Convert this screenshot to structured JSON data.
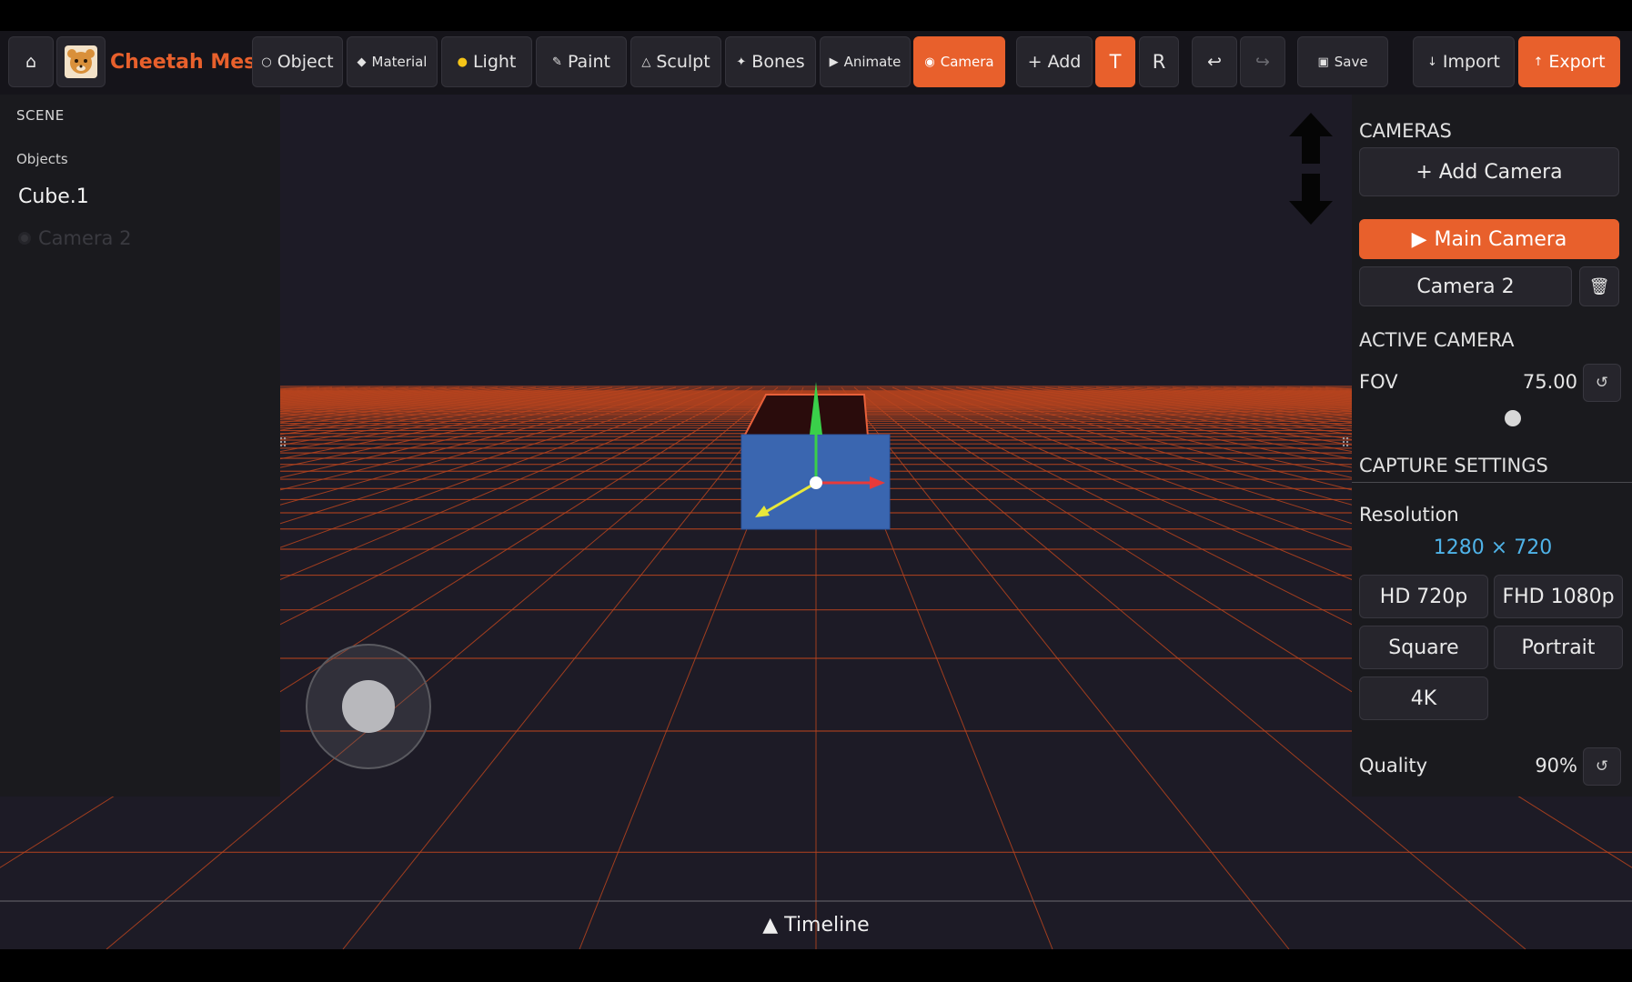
{
  "app": {
    "name": "Cheetah Mesh",
    "accent_color": "#e8602c",
    "link_color": "#4fb3e8"
  },
  "toolbar": {
    "home_icon": "home-icon",
    "tabs": [
      {
        "label": "Object",
        "icon": "circle-outline-icon",
        "active": false
      },
      {
        "label": "Material",
        "icon": "diamond-icon",
        "active": false
      },
      {
        "label": "Light",
        "icon": "bulb-icon",
        "active": false
      },
      {
        "label": "Paint",
        "icon": "brush-icon",
        "active": false
      },
      {
        "label": "Sculpt",
        "icon": "triangle-icon",
        "active": false
      },
      {
        "label": "Bones",
        "icon": "star-icon",
        "active": false
      },
      {
        "label": "Animate",
        "icon": "play-icon",
        "active": false
      },
      {
        "label": "Camera",
        "icon": "record-icon",
        "active": true
      }
    ],
    "add_label": "+ Add",
    "translate_label": "T",
    "rotate_label": "R",
    "undo_icon": "undo-icon",
    "redo_icon": "redo-icon",
    "save_label": "Save",
    "import_label": "Import",
    "export_label": "Export"
  },
  "scene_panel": {
    "header": "SCENE",
    "objects_label": "Objects",
    "objects": [
      "Cube.1",
      "Camera 2"
    ]
  },
  "cameras_panel": {
    "header": "CAMERAS",
    "add_camera_label": "+ Add Camera",
    "cameras": [
      "Main Camera",
      "Camera 2"
    ],
    "selected_camera": "Main Camera",
    "active_header": "ACTIVE CAMERA",
    "fov_label": "FOV",
    "fov_value": "75.00",
    "capture_header": "CAPTURE SETTINGS",
    "resolution_label": "Resolution",
    "resolution_value": "1280 × 720",
    "presets": [
      "HD 720p",
      "FHD 1080p",
      "Square",
      "Portrait",
      "4K"
    ],
    "quality_label": "Quality",
    "quality_value": "90%"
  },
  "bottom": {
    "timeline_label": "▲ Timeline"
  }
}
